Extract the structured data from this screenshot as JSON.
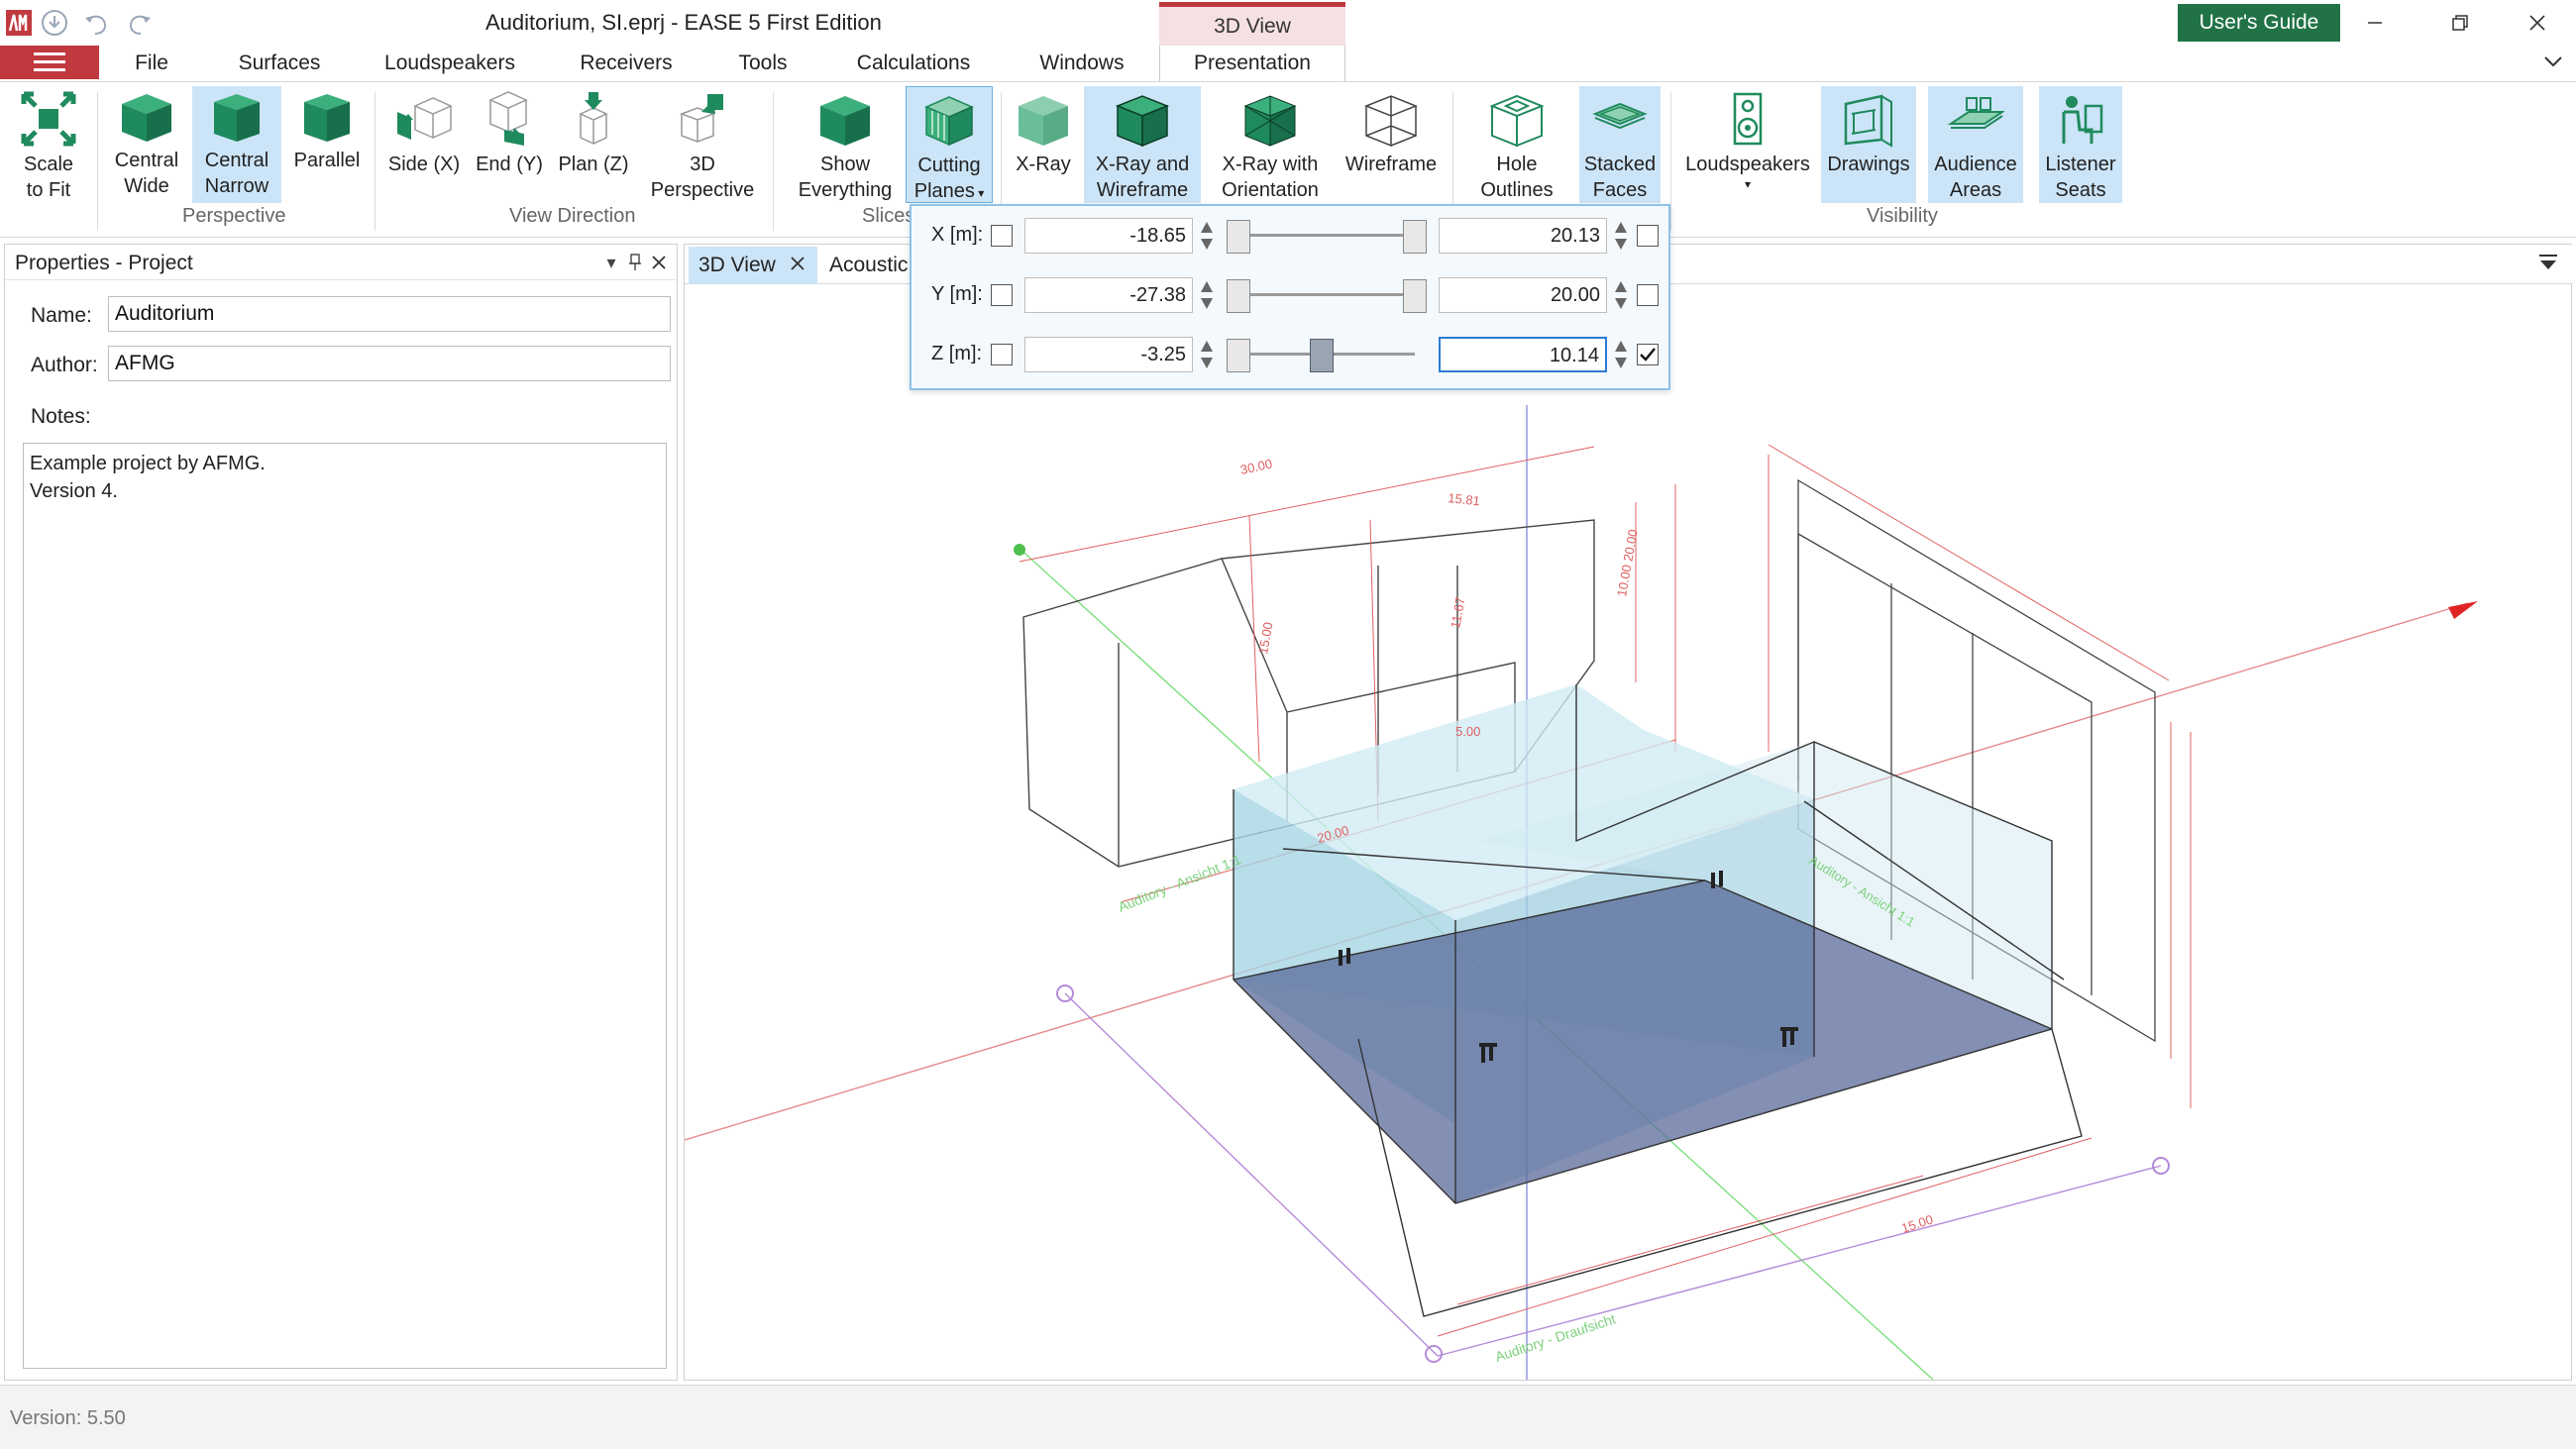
{
  "app": {
    "title": "Auditorium, SI.eprj - EASE 5 First Edition",
    "context_tab_header": "3D View",
    "users_guide": "User's Guide"
  },
  "tabs": [
    "File",
    "Surfaces",
    "Loudspeakers",
    "Receivers",
    "Tools",
    "Calculations",
    "Windows",
    "Presentation"
  ],
  "ribbon": {
    "scale_to_fit": [
      "Scale",
      "to Fit"
    ],
    "central_wide": [
      "Central",
      "Wide"
    ],
    "central_narrow": [
      "Central",
      "Narrow"
    ],
    "parallel": "Parallel",
    "side_x": "Side (X)",
    "end_y": "End (Y)",
    "plan_z": "Plan (Z)",
    "perspective_3d": [
      "3D",
      "Perspective"
    ],
    "show_everything": [
      "Show",
      "Everything"
    ],
    "cutting_planes": [
      "Cutting",
      "Planes"
    ],
    "xray": "X-Ray",
    "xray_wireframe": [
      "X-Ray and",
      "Wireframe"
    ],
    "xray_orientation": [
      "X-Ray with",
      "Orientation"
    ],
    "wireframe": "Wireframe",
    "hole_outlines": [
      "Hole",
      "Outlines"
    ],
    "stacked_faces": [
      "Stacked",
      "Faces"
    ],
    "loudspeakers": "Loudspeakers",
    "drawings": "Drawings",
    "audience_areas": [
      "Audience",
      "Areas"
    ],
    "listener_seats": [
      "Listener",
      "Seats"
    ],
    "groups": {
      "perspective": "Perspective",
      "view_direction": "View Direction",
      "slices": "Slices",
      "visibility": "Visibility"
    }
  },
  "properties": {
    "header": "Properties - Project",
    "name_label": "Name:",
    "name_value": "Auditorium",
    "author_label": "Author:",
    "author_value": "AFMG",
    "notes_label": "Notes:",
    "notes_value": "Example project by AFMG.\nVersion 4."
  },
  "doc_tabs": {
    "view_3d": "3D View",
    "acoustic": "Acoustic R"
  },
  "cutting_planes": {
    "x": {
      "label": "X [m]:",
      "min": "-18.65",
      "max": "20.13",
      "min_checked": false,
      "max_checked": false
    },
    "y": {
      "label": "Y [m]:",
      "min": "-27.38",
      "max": "20.00",
      "min_checked": false,
      "max_checked": false
    },
    "z": {
      "label": "Z [m]:",
      "min": "-3.25",
      "max": "10.14",
      "min_checked": false,
      "max_checked": true
    }
  },
  "drawing_labels": {
    "auditory_side": "Auditory - Ansicht 1:1",
    "auditory_top": "Auditory - Draufsicht",
    "auditory_end": "Auditory - Ansicht 1:1",
    "dim_30": "30.00",
    "dim_15_81": "15.81",
    "dim_15": "15.00",
    "dim_11_67": "11.67",
    "dim_10_20": "10.00 20.00",
    "dim_5": "5.00",
    "dim_20": "20.00",
    "dim_15b": "15.00"
  },
  "status": {
    "version": "Version: 5.50"
  },
  "colors": {
    "accent_red": "#c0393f",
    "ribbon_green": "#1f8a5d",
    "guide_green": "#217346",
    "selected_blue": "#cce4f7"
  }
}
